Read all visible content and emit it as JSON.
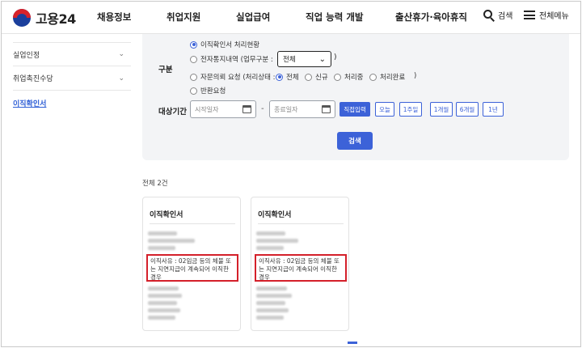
{
  "header": {
    "logo_text": "고용24",
    "nav": [
      "채용정보",
      "취업지원",
      "실업급여",
      "직업 능력 개발",
      "출산휴가·육아휴직"
    ],
    "search_label": "검색",
    "menu_label": "전체메뉴"
  },
  "sidebar": {
    "items": [
      {
        "label": "실업인정",
        "expandable": true
      },
      {
        "label": "취업촉진수당",
        "expandable": true
      },
      {
        "label": "이직확인서",
        "active": true
      }
    ]
  },
  "filter": {
    "category_label": "구분",
    "options": {
      "opt1": "이직확인서 처리현황",
      "opt2_prefix": "전자통지내역 (업무구분 :",
      "opt2_select_value": "전체",
      "opt2_suffix": ")",
      "opt3_prefix": "자문의뢰 요청 (처리상태 :",
      "status_all": "전체",
      "status_new": "신규",
      "status_processing": "처리중",
      "status_done": "처리완료",
      "opt3_suffix": ")",
      "opt4": "반환요청"
    },
    "selected_option": "이직확인서 처리현황",
    "selected_status": "전체",
    "period_label": "대상기간",
    "start_placeholder": "시작일자",
    "dash": "-",
    "end_placeholder": "종료일자",
    "period_buttons": [
      "직접입력",
      "오늘",
      "1주일",
      "1개월",
      "6개월",
      "1년"
    ],
    "active_period": "직접입력",
    "search_button": "검색"
  },
  "results": {
    "total_text": "전체 2건",
    "cards": [
      {
        "title": "이직확인서",
        "reason": "이직사유 : 02임금 등의 체불 또는 지연지급이 계속되어 이직한 경우"
      },
      {
        "title": "이직확인서",
        "reason": "이직사유 : 02임금 등의 체불 또는 지연지급이 계속되어 이직한 경우"
      }
    ]
  },
  "colors": {
    "accent": "#3c62d8",
    "highlight_border": "#d4202a",
    "panel_bg": "#f3f4f6"
  }
}
